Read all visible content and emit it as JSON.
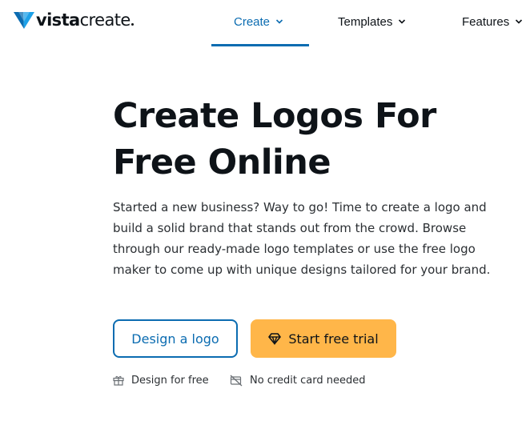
{
  "brand": {
    "name_bold": "vista",
    "name_rest": "create"
  },
  "nav": {
    "items": [
      {
        "label": "Create",
        "active": true,
        "chevron": "chevron-down-icon"
      },
      {
        "label": "Templates",
        "active": false,
        "chevron": "chevron-down-icon"
      },
      {
        "label": "Features",
        "active": false,
        "chevron": "chevron-down-icon"
      }
    ]
  },
  "hero": {
    "title_line1": "Create Logos For",
    "title_line2": "Free Online",
    "description": "Started a new business? Way to go! Time to create a logo and build a solid brand that stands out from the crowd. Browse through our ready-made logo templates or use the free logo maker to come up with unique designs tailored for your brand."
  },
  "actions": {
    "design_label": "Design a logo",
    "trial_label": "Start free trial",
    "trial_icon": "diamond-icon"
  },
  "features": [
    {
      "icon": "gift-icon",
      "label": "Design for free"
    },
    {
      "icon": "no-card-icon",
      "label": "No credit card needed"
    }
  ],
  "colors": {
    "accent": "#0b6cb1",
    "cta": "#ffb649",
    "text": "#0e1318"
  }
}
